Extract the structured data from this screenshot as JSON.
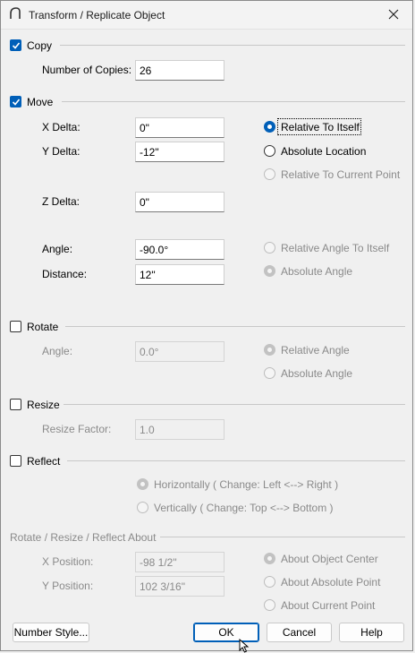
{
  "title": "Transform / Replicate Object",
  "copy": {
    "label": "Copy",
    "checked": true,
    "num_copies_label": "Number of Copies:",
    "num_copies": "26"
  },
  "move": {
    "label": "Move",
    "checked": true,
    "x_delta_label": "X Delta:",
    "x_delta": "0\"",
    "y_delta_label": "Y Delta:",
    "y_delta": "-12\"",
    "z_delta_label": "Z Delta:",
    "z_delta": "0\"",
    "angle_label": "Angle:",
    "angle": "-90.0°",
    "distance_label": "Distance:",
    "distance": "12\"",
    "radio_relative_itself": "Relative To Itself",
    "radio_absolute_location": "Absolute Location",
    "radio_relative_current_point": "Relative To Current Point",
    "radio_relative_angle_itself": "Relative Angle To Itself",
    "radio_absolute_angle": "Absolute Angle"
  },
  "rotate": {
    "label": "Rotate",
    "checked": false,
    "angle_label": "Angle:",
    "angle": "0.0°",
    "radio_relative_angle": "Relative Angle",
    "radio_absolute_angle": "Absolute Angle"
  },
  "resize": {
    "label": "Resize",
    "checked": false,
    "factor_label": "Resize Factor:",
    "factor": "1.0"
  },
  "reflect": {
    "label": "Reflect",
    "checked": false,
    "radio_horizontally": "Horizontally ( Change: Left <--> Right )",
    "radio_vertically": "Vertically ( Change: Top <--> Bottom )"
  },
  "about": {
    "label": "Rotate / Resize / Reflect About",
    "x_position_label": "X Position:",
    "x_position": "-98 1/2\"",
    "y_position_label": "Y Position:",
    "y_position": "102 3/16\"",
    "radio_object_center": "About Object Center",
    "radio_absolute_point": "About Absolute Point",
    "radio_current_point": "About Current Point"
  },
  "buttons": {
    "number_style": "Number Style...",
    "ok": "OK",
    "cancel": "Cancel",
    "help": "Help"
  },
  "colors": {
    "accent": "#005fb8",
    "disabled_text": "#8a8a8a",
    "background": "#f0f0f0"
  }
}
